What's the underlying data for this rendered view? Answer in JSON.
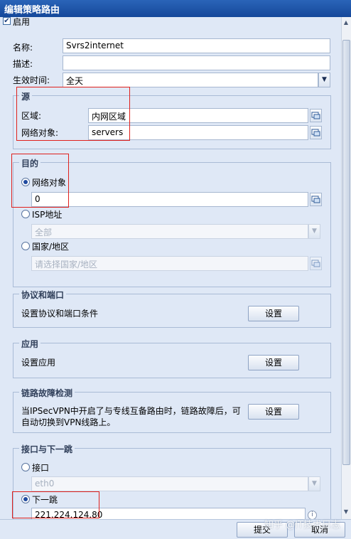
{
  "window": {
    "title": "编辑策略路由"
  },
  "enable": {
    "label": "启用",
    "checked": true
  },
  "form": {
    "name_label": "名称:",
    "name_value": "Svrs2internet",
    "desc_label": "描述:",
    "desc_value": "",
    "time_label": "生效时间:",
    "time_value": "全天"
  },
  "source": {
    "legend": "源",
    "zone_label": "区域:",
    "zone_value": "内网区域",
    "netobj_label": "网络对象:",
    "netobj_value": "servers"
  },
  "dest": {
    "legend": "目的",
    "opt_netobj": "网络对象",
    "netobj_value": "0",
    "opt_isp": "ISP地址",
    "isp_value": "全部",
    "opt_country": "国家/地区",
    "country_placeholder": "请选择国家/地区",
    "selected": "网络对象"
  },
  "protocol": {
    "legend": "协议和端口",
    "desc": "设置协议和端口条件",
    "button": "设置"
  },
  "app": {
    "legend": "应用",
    "desc": "设置应用",
    "button": "设置"
  },
  "link": {
    "legend": "链路故障检测",
    "desc_line1": "当IPSecVPN中开启了与专线互备路由时，链路故障后，可",
    "desc_line2": "自动切换到VPN线路上。",
    "button": "设置"
  },
  "nexthop": {
    "legend": "接口与下一跳",
    "opt_iface": "接口",
    "iface_value": "eth0",
    "opt_nexthop": "下一跳",
    "nexthop_value": "221.224.124.80",
    "selected": "下一跳"
  },
  "footer": {
    "submit": "提交",
    "cancel": "取消",
    "watermark": "知乎 @IT技术日志"
  },
  "colors": {
    "highlight_box": "#e0201c",
    "titlebar": "#1f56aa"
  }
}
